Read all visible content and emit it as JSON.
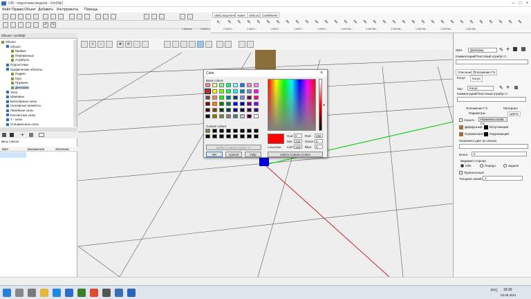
{
  "window": {
    "title": "UM - подготовка модели - UmObj0"
  },
  "menu": [
    "Файл",
    "Правка",
    "Объект",
    "Добавить",
    "Инструменты",
    "Помощь"
  ],
  "ribbon": {
    "tabs": [
      "UMComponent",
      "Hates",
      "UMLoco",
      "CarWheels"
    ],
    "labels": [
      "1 Normal",
      "1 UM Ed...",
      "1 UM D...",
      "1 UM D...",
      "1 UM D...",
      "1 UM P...",
      "1 UM R...",
      "1 UM Ste...",
      "1 UM Ste...",
      "1 UM Ste...",
      "1 UM Ste...",
      "1 UM Ste...",
      "1 UM Ste..."
    ]
  },
  "left_panel": {
    "header": "Объект: UmObj0",
    "tree": [
      {
        "label": "Объект",
        "indent": 0
      },
      {
        "label": "Объект",
        "indent": 1
      },
      {
        "label": "Кривые",
        "indent": 2
      },
      {
        "label": "Переменные",
        "indent": 2
      },
      {
        "label": "Атрибуты",
        "indent": 2
      },
      {
        "label": "Подсистемы",
        "indent": 1
      },
      {
        "label": "Графические объекты",
        "indent": 1
      },
      {
        "label": "Подвес",
        "indent": 2
      },
      {
        "label": "Груз",
        "indent": 2
      },
      {
        "label": "Пружина",
        "indent": 2
      },
      {
        "label": "Демпфер",
        "indent": 2,
        "selected": true
      },
      {
        "label": "Тела",
        "indent": 1
      },
      {
        "label": "Шарниры",
        "indent": 1
      },
      {
        "label": "Биполярные силы",
        "indent": 1
      },
      {
        "label": "Скалярные моменты",
        "indent": 1
      },
      {
        "label": "Линейные силы",
        "indent": 1
      },
      {
        "label": "Контактные силы",
        "indent": 1
      },
      {
        "label": "T - силы",
        "indent": 1
      },
      {
        "label": "Специальные силы",
        "indent": 1
      }
    ],
    "list_header": "Весь список",
    "columns": [
      "Имя",
      "Выражение",
      "Значение"
    ]
  },
  "color_dialog": {
    "title": "Color",
    "basic_colors_label": "Basic colors:",
    "custom_colors_label": "Custom colors:",
    "define_custom_button": "Define Custom Colors >>",
    "ok_button": "OK",
    "cancel_button": "Cancel",
    "help_button": "Help",
    "add_custom_button": "Add to Custom Colors",
    "color_solid_label": "Color|Solid",
    "fields": {
      "hue_label": "Hue:",
      "hue": "0",
      "sat_label": "Sat:",
      "sat": "240",
      "lum_label": "Lum:",
      "lum": "120",
      "red_label": "Red:",
      "red": "255",
      "green_label": "Green:",
      "green": "0",
      "blue_label": "Blue:",
      "blue": "0"
    },
    "basic_colors": [
      "#ff8080",
      "#ffff80",
      "#80ff80",
      "#00ff80",
      "#80ffff",
      "#0080ff",
      "#ff80c0",
      "#ff80ff",
      "#ff0000",
      "#ffff00",
      "#80ff00",
      "#00ff40",
      "#00ffff",
      "#0080c0",
      "#8080c0",
      "#ff00ff",
      "#804040",
      "#ff8040",
      "#00ff00",
      "#008080",
      "#004080",
      "#8080ff",
      "#800040",
      "#ff0080",
      "#800000",
      "#ff8000",
      "#008000",
      "#008040",
      "#0000ff",
      "#0000a0",
      "#800080",
      "#8000ff",
      "#400000",
      "#804000",
      "#004000",
      "#004040",
      "#000080",
      "#000040",
      "#400040",
      "#400080",
      "#000000",
      "#808000",
      "#808040",
      "#808080",
      "#408080",
      "#c0c0c0",
      "#400040",
      "#ffffff"
    ],
    "selected_color": "#ff0000"
  },
  "right_panel": {
    "name_label": "Имя:",
    "name_value": "Демпфер",
    "comment_label": "Комментарий/Текстовый атрибут С",
    "tabs_top": [
      "Описание",
      "Положение ГЭ"
    ],
    "cone_label": "Конус",
    "cone_tab": "Конус",
    "type_label": "Тип:",
    "type_value": "Конус",
    "comment2_label": "Комментарий/Текстовый атрибут С",
    "tabs_mid": [
      "Положение ГЭ",
      "Материал"
    ],
    "tabs_mid2": [
      "Параметры",
      "Цвета"
    ],
    "hide_label": "Скрыть",
    "assign_all_button": "Назначить всем ГЭ",
    "diffuse_label": "Диффузный",
    "emissive_label": "Излучающий",
    "reflect_label": "Отраженный",
    "ambient_label": "Окружающий",
    "assign_from_list_label": "Назначить цвет из списка:",
    "gloss_label": "Блеск:",
    "gloss_value": "0",
    "visible_side_label": "Видимая сторона",
    "side_both": "Обе",
    "side_front": "Передн.",
    "side_back": "Задняя",
    "wire_label": "Проволочный",
    "line_width_label": "Толщина линий:",
    "line_width_value": "1"
  },
  "taskbar": {
    "time": "18:30",
    "date": "03.05.2021",
    "lang": "РУС"
  }
}
